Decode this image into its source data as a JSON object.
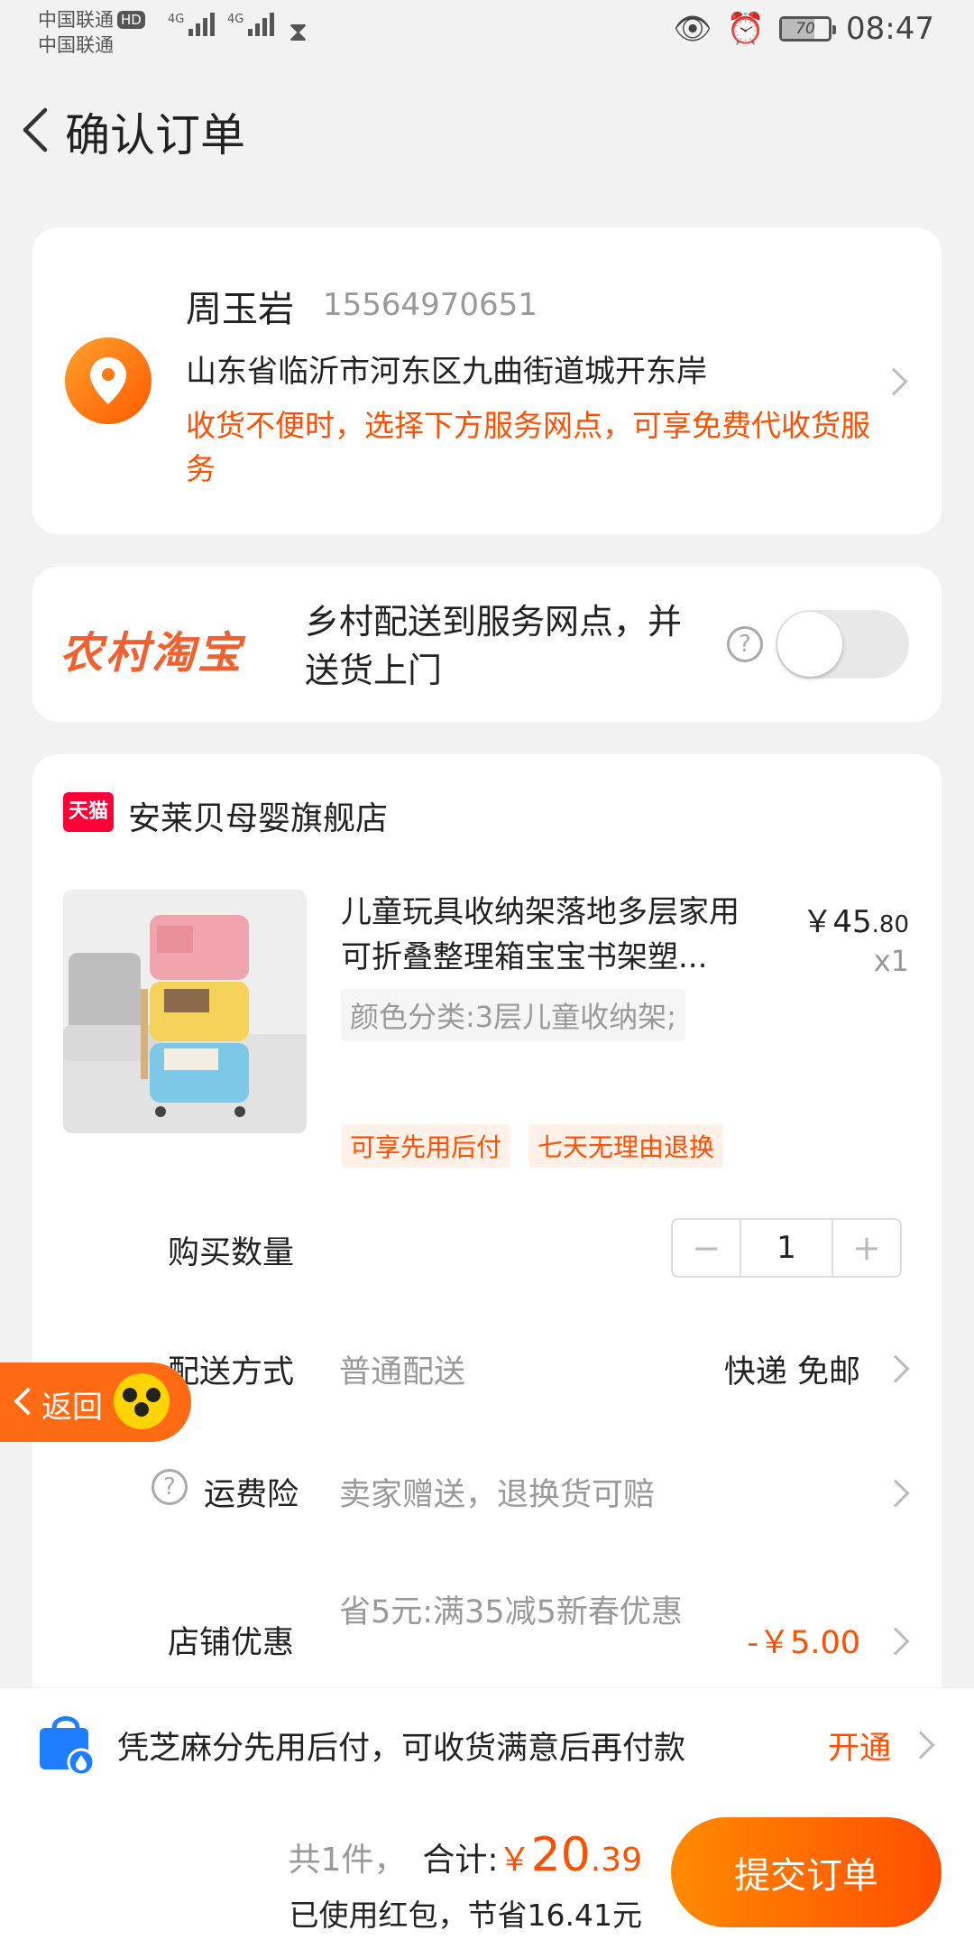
{
  "status_bar": {
    "carrier_1": "中国联通",
    "carrier_2": "中国联通",
    "hd_badge": "HD",
    "net_1": "4G",
    "net_2": "4G",
    "battery": "70",
    "battery_level": 0.7,
    "time": "08:47"
  },
  "nav": {
    "title": "确认订单"
  },
  "address": {
    "name": "周玉岩",
    "phone": "15564970651",
    "address": "山东省临沂市河东区九曲街道城开东岸",
    "note": "收货不便时，选择下方服务网点，可享免费代收货服务"
  },
  "rural": {
    "logo": "农村淘宝",
    "text": "乡村配送到服务网点，并送货上门",
    "help": "?",
    "toggle_on": false
  },
  "order": {
    "shop_badge": "天猫",
    "shop_name": "安莱贝母婴旗舰店",
    "product": {
      "title": "儿童玩具收纳架落地多层家用可折叠整理箱宝宝书架塑...",
      "price_symbol": "￥",
      "price_int": "45",
      "price_dec": ".80",
      "qty": "x1",
      "sku": "颜色分类:3层儿童收纳架;",
      "tags": [
        "可享先用后付",
        "七天无理由退换"
      ]
    },
    "quantity": {
      "label": "购买数量",
      "minus": "−",
      "value": "1",
      "plus": "+"
    },
    "shipping": {
      "label": "配送方式",
      "value": "普通配送",
      "right": "快递 免邮"
    },
    "insurance": {
      "label": "运费险",
      "value": "卖家赠送，退换货可赔",
      "help": "?"
    },
    "discount": {
      "label": "店铺优惠",
      "value": "省5元:满35减5新春优惠",
      "amount": "-￥5.00"
    }
  },
  "float_back": {
    "label": "返回"
  },
  "zhima": {
    "text": "凭芝麻分先用后付，可收货满意后再付款",
    "action": "开通"
  },
  "bottom": {
    "count": "共1件，",
    "total_label": "合计:",
    "total_symbol": "￥",
    "total_int": "20",
    "total_dec": ".39",
    "saved": "已使用红包，节省16.41元",
    "submit": "提交订单"
  },
  "colors": {
    "accent": "#ff5000",
    "tmall_red": "#ff0036",
    "rural_orange": "#f2602e"
  }
}
